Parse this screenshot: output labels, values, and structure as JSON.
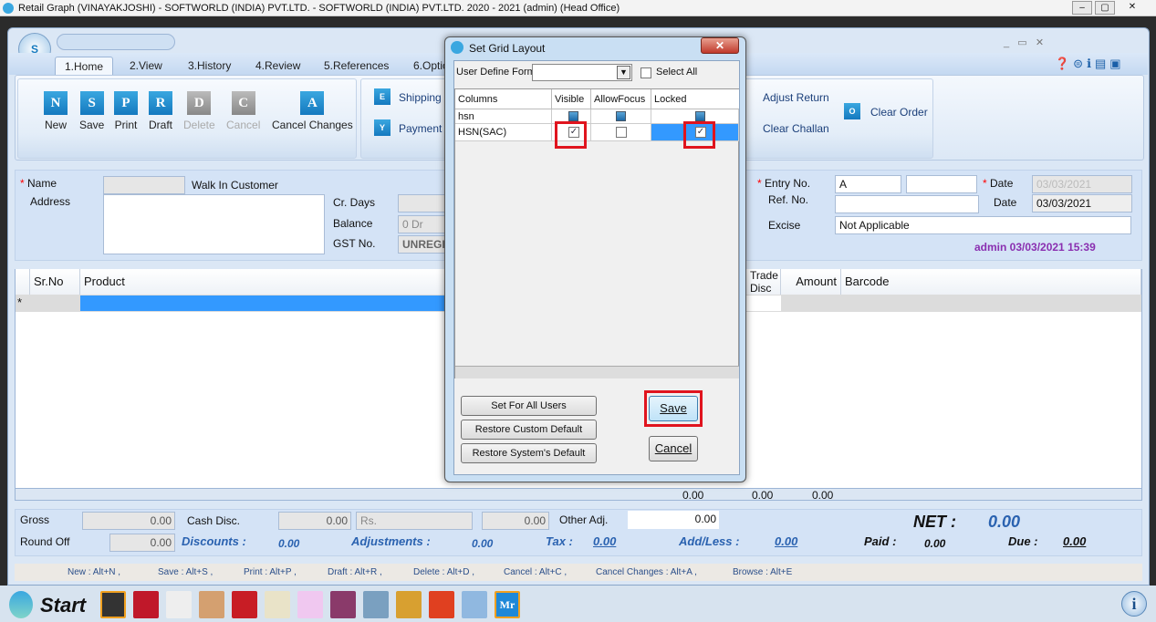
{
  "window": {
    "title": "Retail Graph (VINAYAKJOSHI) - SOFTWORLD (INDIA) PVT.LTD. - SOFTWORLD (INDIA) PVT.LTD.  2020 - 2021 (admin) (Head Office)"
  },
  "ribbon": {
    "tabs": [
      "1.Home",
      "2.View",
      "3.History",
      "4.Review",
      "5.References",
      "6.Optio"
    ],
    "home_buttons": [
      {
        "label": "New",
        "icon": "N"
      },
      {
        "label": "Save",
        "icon": "S"
      },
      {
        "label": "Print",
        "icon": "P"
      },
      {
        "label": "Draft",
        "icon": "R"
      },
      {
        "label": "Delete",
        "icon": "D"
      },
      {
        "label": "Cancel",
        "icon": "C"
      },
      {
        "label": "Cancel Changes",
        "icon": "A"
      }
    ],
    "small_buttons": {
      "shipping": "Shipping",
      "payment": "Payment",
      "adjust_return": "Adjust Return",
      "clear_challan": "Clear Challan",
      "clear_order": "Clear Order"
    }
  },
  "form": {
    "name_label": "Name",
    "name_value": "Walk In Customer",
    "address_label": "Address",
    "cr_days_label": "Cr. Days",
    "balance_label": "Balance",
    "balance_value": "0 Dr",
    "gst_label": "GST No.",
    "gst_value": "UNREGI",
    "entry_no_label": "Entry No.",
    "entry_no_value": "A",
    "ref_no_label": "Ref. No.",
    "date_label": "Date",
    "date1_value": "03/03/2021",
    "date2_value": "03/03/2021",
    "excise_label": "Excise",
    "excise_value": "Not Applicable",
    "user_stamp": "admin 03/03/2021 15:39"
  },
  "grid": {
    "columns": [
      "Sr.No",
      "Product",
      "Trade Disc",
      "Amount",
      "Barcode"
    ],
    "new_row_marker": "*",
    "footer_totals": [
      "0.00",
      "0.00",
      "0.00"
    ]
  },
  "totals": {
    "gross_label": "Gross",
    "gross_value": "0.00",
    "cash_disc_label": "Cash Disc.",
    "cash_disc_value": "0.00",
    "cash_disc_unit": "Rs.",
    "cash_disc_amount": "0.00",
    "other_adj_label": "Other Adj.",
    "other_adj_value": "0.00",
    "round_off_label": "Round Off",
    "round_off_value": "0.00",
    "discounts_label": "Discounts :",
    "discounts_value": "0.00",
    "adjustments_label": "Adjustments :",
    "adjustments_value": "0.00",
    "tax_label": "Tax :",
    "tax_value": "0.00",
    "addless_label": "Add/Less :",
    "addless_value": "0.00",
    "net_label": "NET :",
    "net_value": "0.00",
    "paid_label": "Paid :",
    "paid_value": "0.00",
    "due_label": "Due :",
    "due_value": "0.00"
  },
  "shortcuts": [
    "New : Alt+N ,",
    "Save : Alt+S ,",
    "Print : Alt+P ,",
    "Draft : Alt+R ,",
    "Delete : Alt+D ,",
    "Cancel : Alt+C ,",
    "Cancel Changes : Alt+A ,",
    "Browse : Alt+E"
  ],
  "taskbar": {
    "start_label": "Start"
  },
  "dialog": {
    "title": "Set Grid Layout",
    "user_define_form_label": "User Define Form",
    "user_define_form_value": "",
    "select_all_label": "Select All",
    "columns": [
      "Columns",
      "Visible",
      "AllowFocus",
      "Locked"
    ],
    "rows": [
      {
        "name": "hsn",
        "visible": true,
        "allow_focus": true,
        "locked": true
      },
      {
        "name": "HSN(SAC)",
        "visible": true,
        "allow_focus": false,
        "locked": true
      }
    ],
    "set_all_users": "Set For All Users",
    "restore_custom": "Restore Custom Default",
    "restore_system": "Restore System's Default",
    "save": "Save",
    "cancel": "Cancel"
  },
  "colors": {
    "accent": "#1479bf",
    "highlight": "#3399ff",
    "annotation_red": "#e0141e",
    "stamp": "#8a2fb0"
  }
}
